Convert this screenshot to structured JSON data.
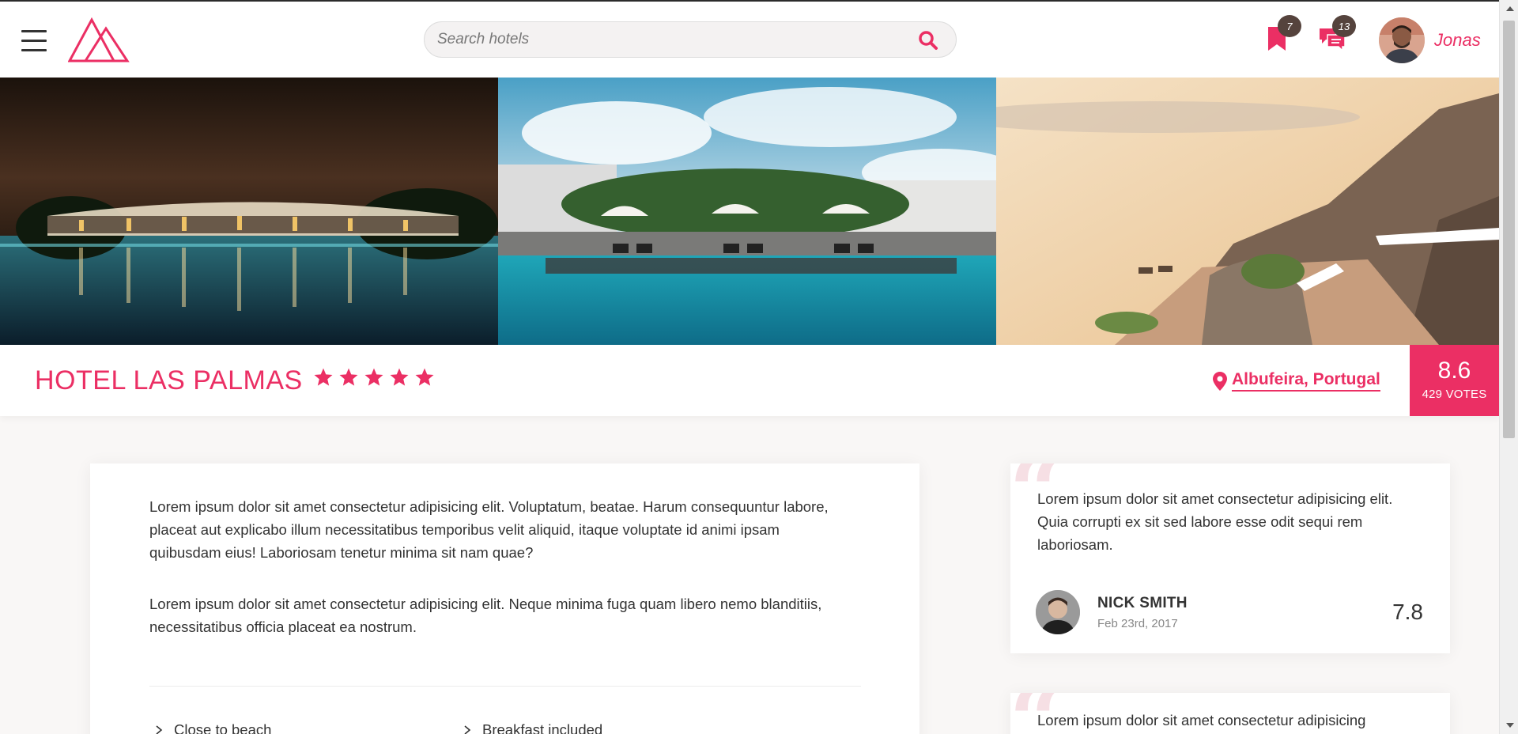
{
  "header": {
    "menu_icon": "hamburger-menu-icon",
    "logo_icon": "triangles-logo-icon",
    "search": {
      "placeholder": "Search hotels",
      "value": "",
      "icon": "search-icon"
    },
    "bookmarks": {
      "icon": "bookmark-icon",
      "count": "7"
    },
    "messages": {
      "icon": "chat-icon",
      "count": "13"
    },
    "user": {
      "name": "Jonas",
      "avatar": "user-avatar"
    }
  },
  "gallery": {
    "photos": [
      "hotel-pool-night-photo",
      "hotel-pool-day-photo",
      "cliff-terrace-sunset-photo"
    ]
  },
  "overview": {
    "name": "HOTEL LAS PALMAS",
    "stars": 5,
    "location": "Albufeira, Portugal",
    "rating": {
      "average": "8.6",
      "count": "429 VOTES"
    }
  },
  "description": {
    "paragraphs": [
      "Lorem ipsum dolor sit amet consectetur adipisicing elit. Voluptatum, beatae. Harum consequuntur labore, placeat aut explicabo illum necessitatibus temporibus velit aliquid, itaque voluptate id animi ipsam quibusdam eius! Laboriosam tenetur minima sit nam quae?",
      "Lorem ipsum dolor sit amet consectetur adipisicing elit. Neque minima fuga quam libero nemo blanditiis, necessitatibus officia placeat ea nostrum."
    ],
    "features": [
      "Close to beach",
      "Breakfast included"
    ]
  },
  "reviews": [
    {
      "text": "Lorem ipsum dolor sit amet consectetur adipisicing elit. Quia corrupti ex sit sed labore esse odit sequi rem laboriosam.",
      "name": "NICK SMITH",
      "date": "Feb 23rd, 2017",
      "rating": "7.8"
    },
    {
      "text": "Lorem ipsum dolor sit amet consectetur adipisicing"
    }
  ],
  "colors": {
    "primary": "#eb2f64",
    "badge": "#55433d",
    "background": "#f9f7f6",
    "text": "#333333"
  }
}
